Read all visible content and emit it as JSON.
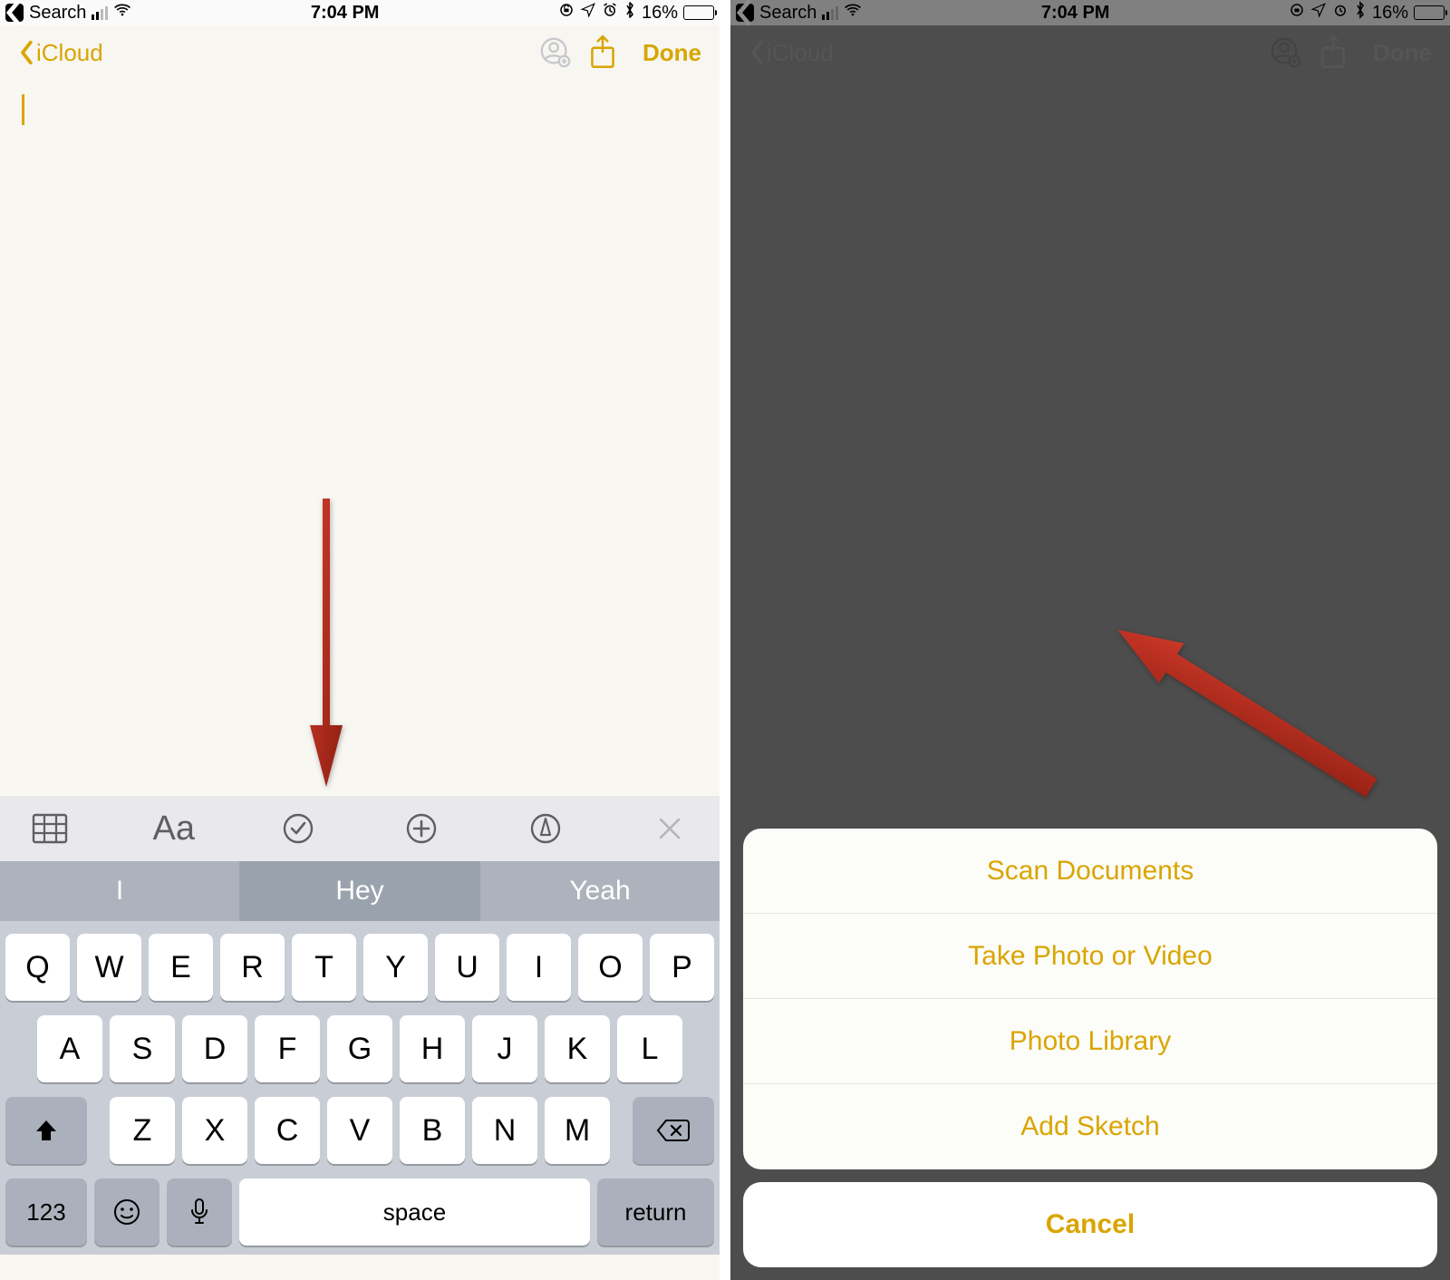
{
  "status": {
    "search_label": "Search",
    "time": "7:04 PM",
    "battery_percent": "16%"
  },
  "nav": {
    "back_label": "iCloud",
    "done_label": "Done"
  },
  "toolbar_icons": {
    "table": "table-icon",
    "format": "Aa",
    "checklist": "checklist-icon",
    "add": "plus-circle-icon",
    "markup": "markup-icon",
    "close": "close-icon"
  },
  "suggestions": [
    "I",
    "Hey",
    "Yeah"
  ],
  "keys_row1": [
    "Q",
    "W",
    "E",
    "R",
    "T",
    "Y",
    "U",
    "I",
    "O",
    "P"
  ],
  "keys_row2": [
    "A",
    "S",
    "D",
    "F",
    "G",
    "H",
    "J",
    "K",
    "L"
  ],
  "keys_row3": [
    "Z",
    "X",
    "C",
    "V",
    "B",
    "N",
    "M"
  ],
  "keys_fn": {
    "num": "123",
    "space": "space",
    "return": "return"
  },
  "action_sheet": {
    "items": [
      "Scan Documents",
      "Take Photo or Video",
      "Photo Library",
      "Add Sketch"
    ],
    "cancel": "Cancel"
  }
}
